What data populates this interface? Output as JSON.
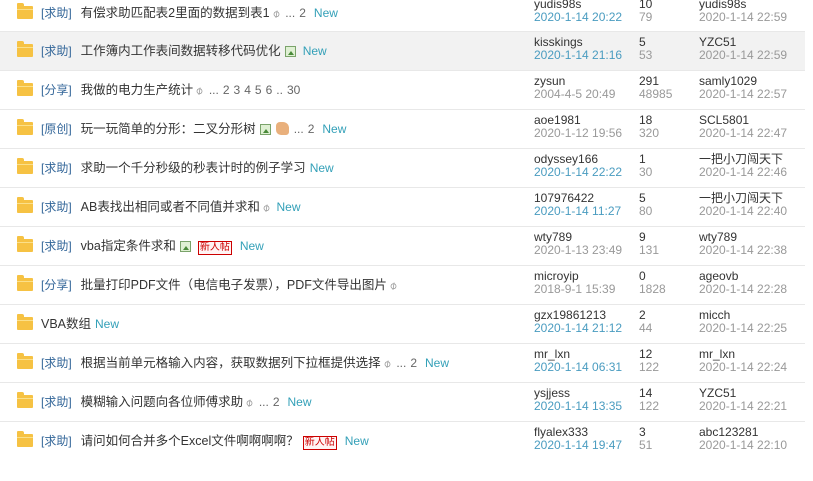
{
  "threads": [
    {
      "category": "[求助]",
      "title": "有偿求助匹配表2里面的数据到表1",
      "attach": true,
      "img": false,
      "hand": false,
      "newbie": false,
      "pages": [
        "...",
        "2"
      ],
      "new": "New",
      "author": "yudis98s",
      "date": "2020-1-14 20:22",
      "date_recent": true,
      "replies": "10",
      "views": "79",
      "last_user": "yudis98s",
      "last_time": "2020-1-14 22:59"
    },
    {
      "category": "[求助]",
      "title": "工作簿内工作表间数据转移代码优化",
      "attach": false,
      "img": true,
      "hand": false,
      "newbie": false,
      "pages": [],
      "new": "New",
      "author": "kisskings",
      "date": "2020-1-14 21:16",
      "date_recent": true,
      "replies": "5",
      "views": "53",
      "last_user": "YZC51",
      "last_time": "2020-1-14 22:59"
    },
    {
      "category": "[分享]",
      "title": "我做的电力生产统计",
      "attach": true,
      "img": false,
      "hand": false,
      "newbie": false,
      "pages": [
        "...",
        "2",
        "3",
        "4",
        "5",
        "6",
        "..",
        "30"
      ],
      "new": "",
      "author": "zysun",
      "date": "2004-4-5 20:49",
      "date_recent": false,
      "replies": "291",
      "views": "48985",
      "last_user": "samly1029",
      "last_time": "2020-1-14 22:57"
    },
    {
      "category": "[原创]",
      "title": "玩一玩简单的分形：二叉分形树",
      "attach": false,
      "img": true,
      "hand": true,
      "newbie": false,
      "pages": [
        "...",
        "2"
      ],
      "new": "New",
      "author": "aoe1981",
      "date": "2020-1-12 19:56",
      "date_recent": false,
      "replies": "18",
      "views": "320",
      "last_user": "SCL5801",
      "last_time": "2020-1-14 22:47"
    },
    {
      "category": "[求助]",
      "title": "求助一个千分秒级的秒表计时的例子学习",
      "attach": false,
      "img": false,
      "hand": false,
      "newbie": false,
      "pages": [],
      "new": "New",
      "author": "odyssey166",
      "date": "2020-1-14 22:22",
      "date_recent": true,
      "replies": "1",
      "views": "30",
      "last_user": "一把小刀闯天下",
      "last_time": "2020-1-14 22:46"
    },
    {
      "category": "[求助]",
      "title": "AB表找出相同或者不同值并求和",
      "attach": true,
      "img": false,
      "hand": false,
      "newbie": false,
      "pages": [],
      "new": "New",
      "author": "107976422",
      "date": "2020-1-14 11:27",
      "date_recent": true,
      "replies": "5",
      "views": "80",
      "last_user": "一把小刀闯天下",
      "last_time": "2020-1-14 22:40"
    },
    {
      "category": "[求助]",
      "title": "vba指定条件求和",
      "attach": false,
      "img": true,
      "hand": false,
      "newbie": true,
      "pages": [],
      "new": "New",
      "author": "wty789",
      "date": "2020-1-13 23:49",
      "date_recent": false,
      "replies": "9",
      "views": "131",
      "last_user": "wty789",
      "last_time": "2020-1-14 22:38"
    },
    {
      "category": "[分享]",
      "title": "批量打印PDF文件（电信电子发票），PDF文件导出图片",
      "attach": true,
      "img": false,
      "hand": false,
      "newbie": false,
      "pages": [],
      "new": "",
      "author": "microyip",
      "date": "2018-9-1 15:39",
      "date_recent": false,
      "replies": "0",
      "views": "1828",
      "last_user": "ageovb",
      "last_time": "2020-1-14 22:28"
    },
    {
      "category": "",
      "title": "VBA数组",
      "attach": false,
      "img": false,
      "hand": false,
      "newbie": false,
      "pages": [],
      "new": "New",
      "author": "gzx19861213",
      "date": "2020-1-14 21:12",
      "date_recent": true,
      "replies": "2",
      "views": "44",
      "last_user": "micch",
      "last_time": "2020-1-14 22:25"
    },
    {
      "category": "[求助]",
      "title": "根据当前单元格输入内容，获取数据列下拉框提供选择",
      "attach": true,
      "img": false,
      "hand": false,
      "newbie": false,
      "pages": [
        "...",
        "2"
      ],
      "new": "New",
      "author": "mr_lxn",
      "date": "2020-1-14 06:31",
      "date_recent": true,
      "replies": "12",
      "views": "122",
      "last_user": "mr_lxn",
      "last_time": "2020-1-14 22:24"
    },
    {
      "category": "[求助]",
      "title": "模糊输入问题向各位师傅求助",
      "attach": true,
      "img": false,
      "hand": false,
      "newbie": false,
      "pages": [
        "...",
        "2"
      ],
      "new": "New",
      "author": "ysjjess",
      "date": "2020-1-14 13:35",
      "date_recent": true,
      "replies": "14",
      "views": "122",
      "last_user": "YZC51",
      "last_time": "2020-1-14 22:21"
    },
    {
      "category": "[求助]",
      "title": "请问如何合并多个Excel文件啊啊啊啊？",
      "attach": false,
      "img": false,
      "hand": false,
      "newbie": true,
      "pages": [],
      "new": "New",
      "author": "flyalex333",
      "date": "2020-1-14 19:47",
      "date_recent": true,
      "replies": "3",
      "views": "51",
      "last_user": "abc123281",
      "last_time": "2020-1-14 22:10"
    }
  ],
  "newbie_label": "新人帖"
}
